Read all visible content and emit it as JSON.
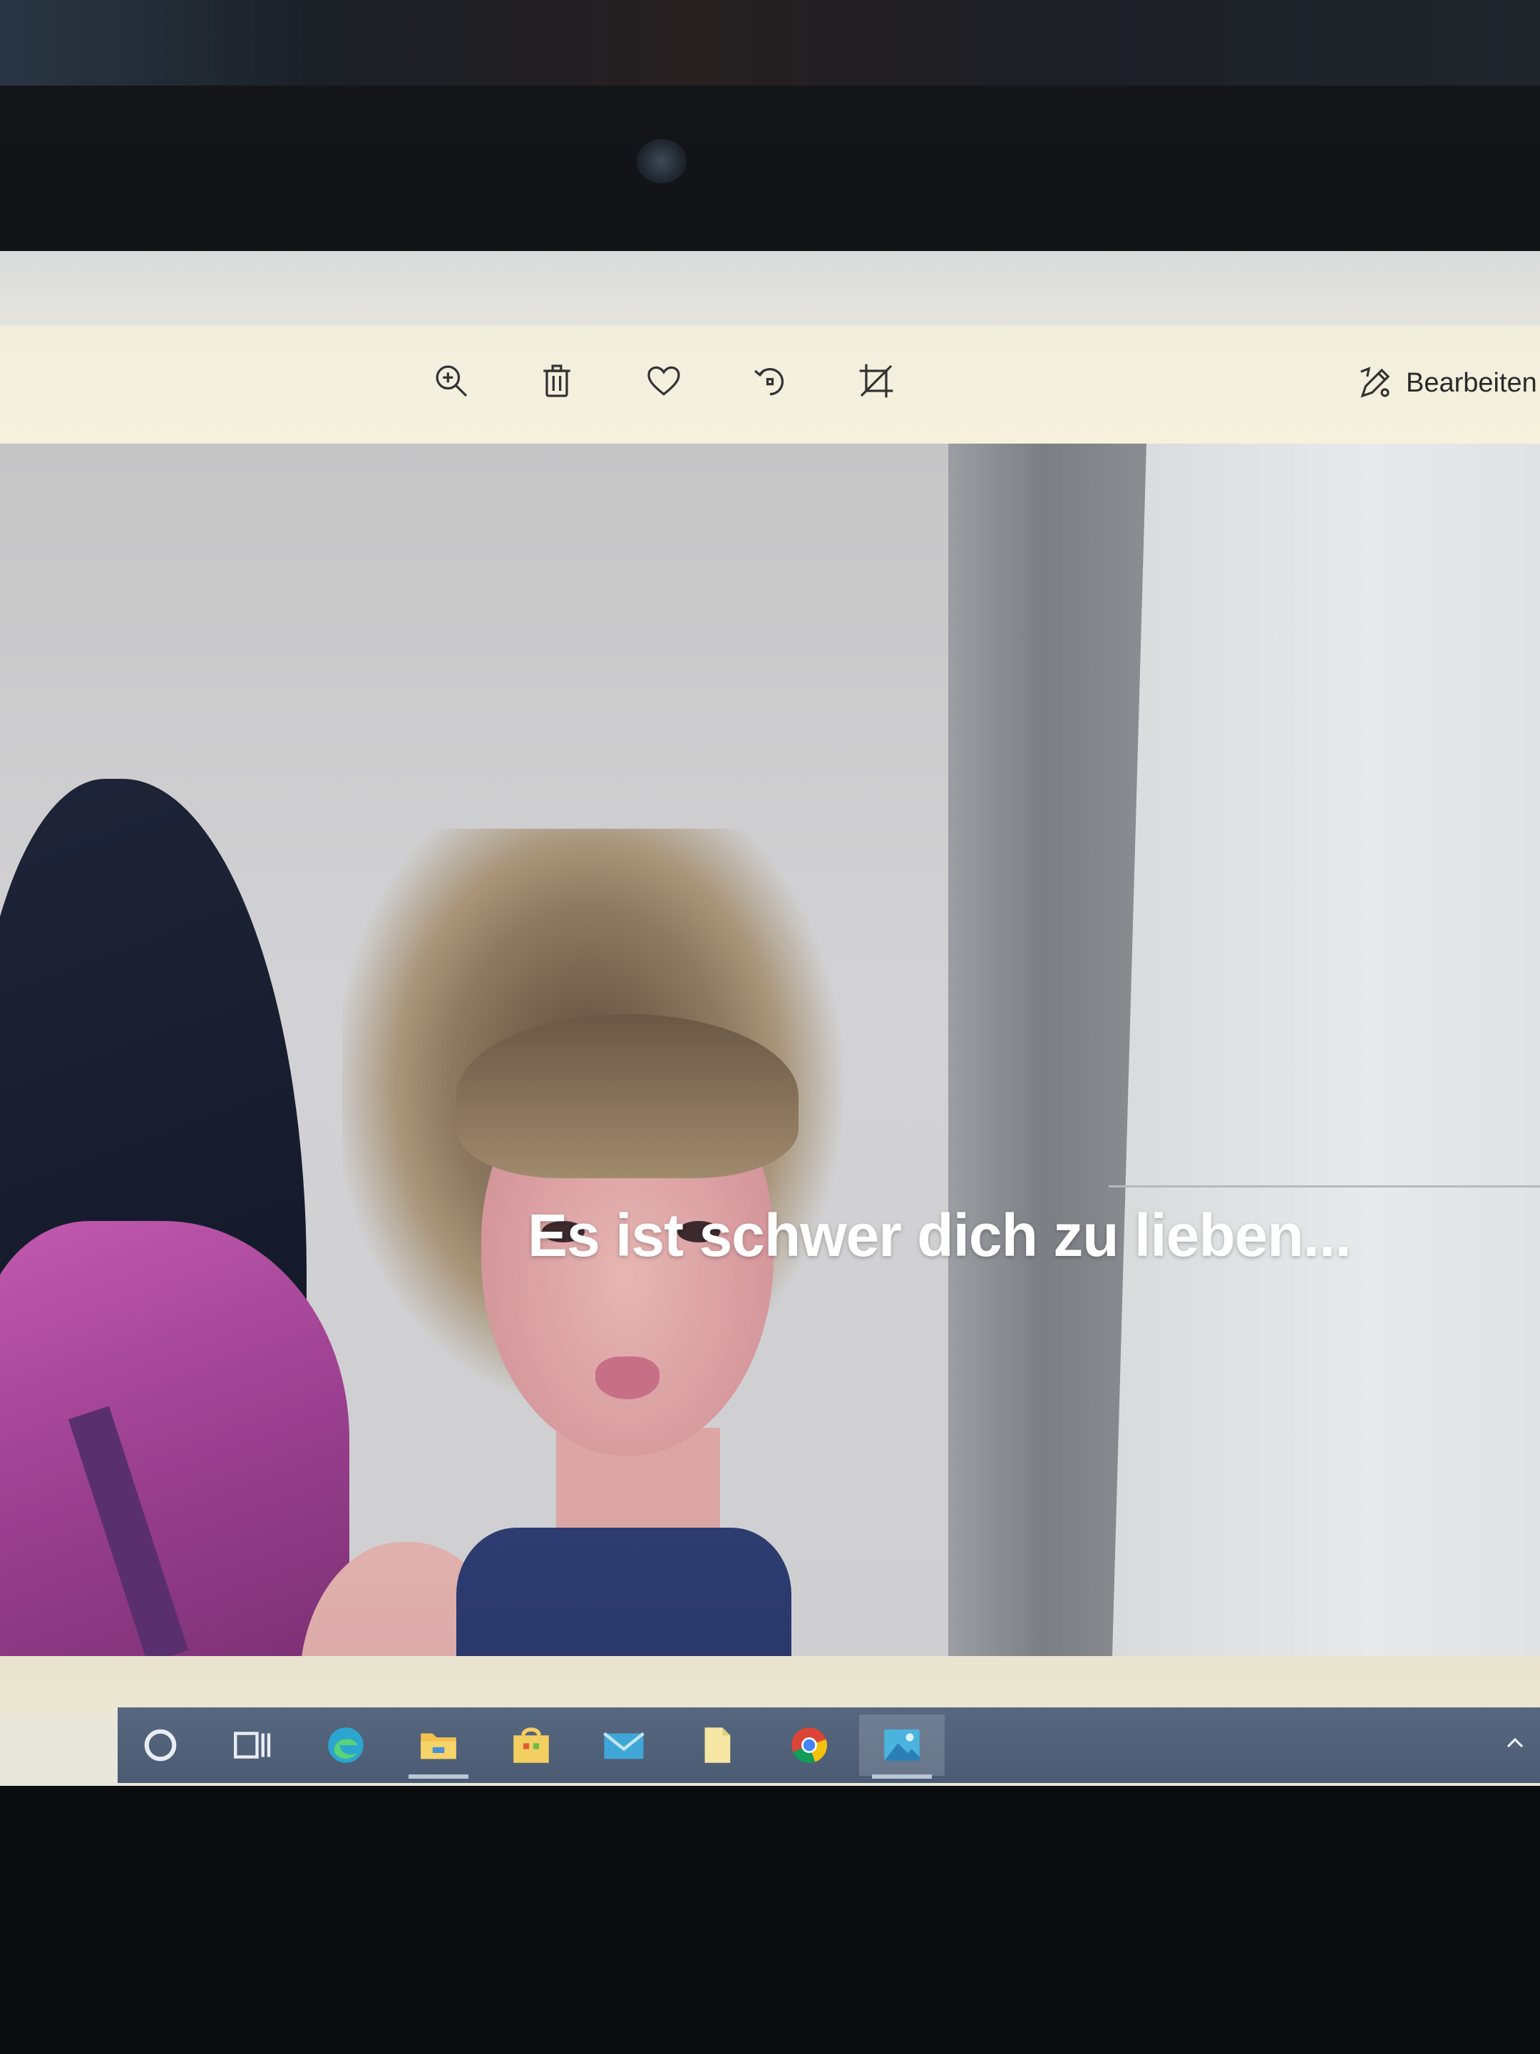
{
  "toolbar": {
    "tools": [
      {
        "name": "zoom-in-icon"
      },
      {
        "name": "delete-icon"
      },
      {
        "name": "heart-icon"
      },
      {
        "name": "rotate-icon"
      },
      {
        "name": "crop-icon"
      }
    ],
    "edit_label": "Bearbeiten u"
  },
  "photo": {
    "caption": "Es ist schwer dich zu lieben..."
  },
  "taskbar": {
    "items": [
      {
        "name": "cortana-icon"
      },
      {
        "name": "task-view-icon"
      },
      {
        "name": "edge-icon"
      },
      {
        "name": "file-explorer-icon"
      },
      {
        "name": "store-icon"
      },
      {
        "name": "mail-icon"
      },
      {
        "name": "notes-icon"
      },
      {
        "name": "chrome-icon"
      },
      {
        "name": "photos-icon"
      }
    ],
    "active_item": "photos-icon"
  },
  "colors": {
    "toolbar_bg": "#f3efdd",
    "taskbar_bg": "#4f6078",
    "caption": "#ffffff"
  }
}
